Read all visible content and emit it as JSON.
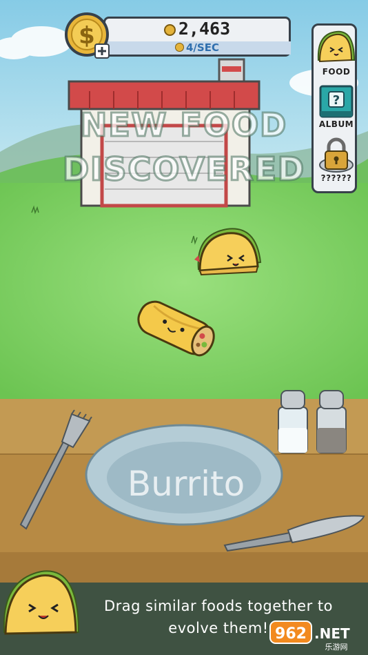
{
  "hud": {
    "coins": "2,463",
    "coins_per_sec": "4/SEC",
    "dollar_symbol": "$"
  },
  "side_menu": {
    "food_label": "FOOD",
    "album_label": "ALBUM",
    "album_symbol": "?",
    "locked_label": "??????"
  },
  "banner": {
    "line1": "NEW FOOD",
    "line2": "DISCOVERED"
  },
  "plate": {
    "food_name": "Burrito"
  },
  "tip": {
    "line1": "Drag similar foods together to",
    "line2": "evolve them!"
  },
  "watermark": {
    "text1": "962",
    "text2": ".NET",
    "sub": "乐游网"
  },
  "colors": {
    "sky": "#8ecfe6",
    "grass": "#7cd064",
    "table": "#b78a44",
    "accent_blue": "#2f6fae",
    "coin_gold": "#e4b33b"
  }
}
